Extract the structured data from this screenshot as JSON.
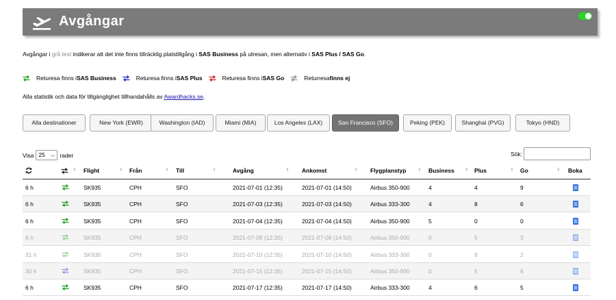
{
  "header": {
    "title": "Avgångar",
    "toggle_on": true,
    "toggle_color": "#27d627",
    "banner_color": "#7b7b7b"
  },
  "info": {
    "part1": "Avgångar i ",
    "grey": "grå text",
    "part2": " indikerar att det inte finns tillräcklig platstillgång i ",
    "bold1": "SAS Business",
    "part3": " på utresan, men alternativ i ",
    "bold2": "SAS Plus / SAS Go",
    "part4": "."
  },
  "legend": [
    {
      "icon": "return-green-icon",
      "text": "Returesa finns i ",
      "bold": "SAS Business",
      "tail": "",
      "color": "#1a9e1a"
    },
    {
      "icon": "return-blue-icon",
      "text": "Returesa finns i ",
      "bold": "SAS Plus",
      "tail": "",
      "color": "#1a23c9"
    },
    {
      "icon": "return-red-icon",
      "text": "Returesa finns i ",
      "bold": "SAS Go",
      "tail": "",
      "color": "#d11a1a"
    },
    {
      "icon": "return-none-icon",
      "text": "Returresa ",
      "bold": "finns ej",
      "tail": "",
      "color": "#9a9a9a"
    }
  ],
  "stats": {
    "text": "Alla statistik och data för tillgänglighet tillhandahålls av ",
    "link": "Awardhacks.se",
    "tail": "."
  },
  "filters": [
    {
      "label": "Alla destinationer",
      "active": false
    },
    {
      "label": "New York (EWR)",
      "active": false
    },
    {
      "label": "Washington (IAD)",
      "active": false
    },
    {
      "label": "Miami (MIA)",
      "active": false
    },
    {
      "label": "Los Angeles (LAX)",
      "active": false
    },
    {
      "label": "San Francisco (SFO)",
      "active": true
    },
    {
      "label": "Peking (PEK)",
      "active": false
    },
    {
      "label": "Shanghai (PVG)",
      "active": false
    },
    {
      "label": "Tokyo (HND)",
      "active": false
    }
  ],
  "table_controls": {
    "show_prefix": "Visa",
    "page_size": "25",
    "show_suffix": "rader",
    "search_label": "Sök:",
    "search_value": ""
  },
  "table": {
    "columns": [
      "",
      "",
      "Flight",
      "Från",
      "Till",
      "Avgång",
      "Ankomst",
      "Flygplanstyp",
      "Business",
      "Plus",
      "Go",
      "Boka"
    ],
    "rows": [
      {
        "duration": "6 h",
        "ret": "green",
        "flight": "SK935",
        "from": "CPH",
        "to": "SFO",
        "dep": "2021-07-01 (12:35)",
        "arr": "2021-07-01 (14:50)",
        "aircraft": "Airbus 350-900",
        "business": "4",
        "plus": "4",
        "go": "9",
        "dim": false
      },
      {
        "duration": "6 h",
        "ret": "green",
        "flight": "SK935",
        "from": "CPH",
        "to": "SFO",
        "dep": "2021-07-03 (12:35)",
        "arr": "2021-07-03 (14:50)",
        "aircraft": "Airbus 333-300",
        "business": "4",
        "plus": "8",
        "go": "6",
        "dim": false
      },
      {
        "duration": "6 h",
        "ret": "green",
        "flight": "SK935",
        "from": "CPH",
        "to": "SFO",
        "dep": "2021-07-04 (12:35)",
        "arr": "2021-07-04 (14:50)",
        "aircraft": "Airbus 350-900",
        "business": "5",
        "plus": "0",
        "go": "0",
        "dim": false
      },
      {
        "duration": "6 h",
        "ret": "green",
        "flight": "SK935",
        "from": "CPH",
        "to": "SFO",
        "dep": "2021-07-08 (12:35)",
        "arr": "2021-07-08 (14:50)",
        "aircraft": "Airbus 350-900",
        "business": "0",
        "plus": "5",
        "go": "3",
        "dim": true
      },
      {
        "duration": "31 h",
        "ret": "green",
        "flight": "SK935",
        "from": "CPH",
        "to": "SFO",
        "dep": "2021-07-10 (12:35)",
        "arr": "2021-07-10 (14:50)",
        "aircraft": "Airbus 333-300",
        "business": "0",
        "plus": "6",
        "go": "2",
        "dim": true
      },
      {
        "duration": "30 h",
        "ret": "blue",
        "flight": "SK935",
        "from": "CPH",
        "to": "SFO",
        "dep": "2021-07-15 (12:35)",
        "arr": "2021-07-15 (14:50)",
        "aircraft": "Airbus 350-900",
        "business": "0",
        "plus": "5",
        "go": "6",
        "dim": true
      },
      {
        "duration": "6 h",
        "ret": "green",
        "flight": "SK935",
        "from": "CPH",
        "to": "SFO",
        "dep": "2021-07-17 (12:35)",
        "arr": "2021-07-17 (14:50)",
        "aircraft": "Airbus 333-300",
        "business": "4",
        "plus": "6",
        "go": "5",
        "dim": false
      }
    ]
  }
}
